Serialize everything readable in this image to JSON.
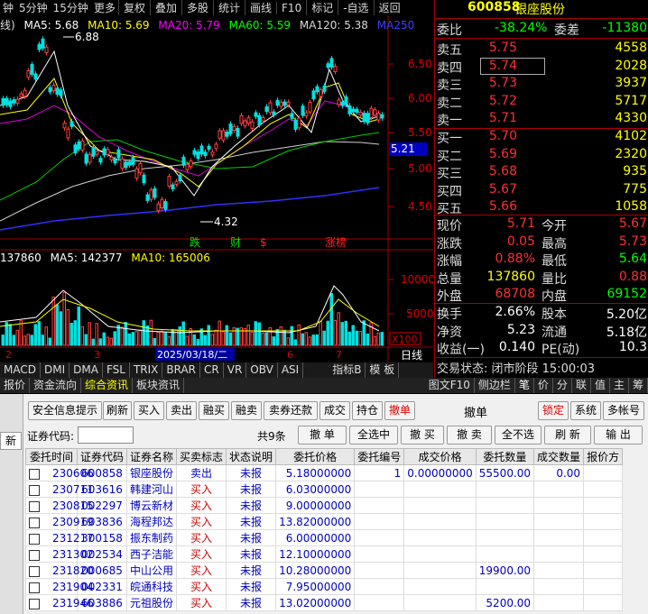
{
  "toolbar": {
    "periods": [
      "钟",
      "5分钟",
      "15分钟",
      "更多"
    ],
    "buttons": [
      "复权",
      "叠加",
      "多股",
      "统计",
      "画线",
      "F10",
      "标记",
      "-自选",
      "返回"
    ]
  },
  "chart": {
    "ma_legend": {
      "prefix": "线)",
      "ma5": "MA5: 5.68",
      "ma10": "MA10: 5.69",
      "ma20": "MA20: 5.79",
      "ma60": "MA60: 5.59",
      "ma120": "MA120: 5.38",
      "ma250": "MA250"
    },
    "price_ticks": [
      "6.50",
      "6.00",
      "5.50",
      "5.00",
      "4.50"
    ],
    "current_price_tag": "5.21",
    "high_label": "6.88",
    "low_label": "4.32",
    "event_markers": [
      "跌",
      "财",
      "$",
      "涨榜"
    ],
    "vol_legend": {
      "vol": "137860",
      "ma5": "MA5: 142377",
      "ma10": "MA10: 165006"
    },
    "vol_ticks": [
      "10000",
      "5000"
    ],
    "vol_unit": "X100",
    "month_ticks": [
      "2",
      "3",
      "6",
      "7"
    ],
    "date_label": "2025/03/18/二",
    "day_label": "日线",
    "colors": {
      "ma5": "#ffffff",
      "ma10": "#ffff00",
      "ma20": "#ff00ff",
      "ma60": "#00ff00",
      "ma120": "#d0d0d0",
      "ma250": "#4040ff"
    }
  },
  "indicator_tabs": [
    "MACD",
    "DMI",
    "DMA",
    "FSL",
    "TRIX",
    "BRAR",
    "CR",
    "VR",
    "OBV",
    "ASI",
    "指标B",
    "模 板"
  ],
  "quote": {
    "code": "600858",
    "name": "银座股份",
    "weibi_label": "委比",
    "weibi": "-38.24%",
    "weicha_label": "委差",
    "weicha": "-11380",
    "asks": [
      {
        "label": "卖五",
        "price": "5.75",
        "vol": "4558"
      },
      {
        "label": "卖四",
        "price": "5.74",
        "vol": "2028"
      },
      {
        "label": "卖三",
        "price": "5.73",
        "vol": "3937"
      },
      {
        "label": "卖二",
        "price": "5.72",
        "vol": "5717"
      },
      {
        "label": "卖一",
        "price": "5.71",
        "vol": "4330"
      }
    ],
    "bids": [
      {
        "label": "买一",
        "price": "5.70",
        "vol": "4102"
      },
      {
        "label": "买二",
        "price": "5.69",
        "vol": "2320"
      },
      {
        "label": "买三",
        "price": "5.68",
        "vol": "935"
      },
      {
        "label": "买四",
        "price": "5.67",
        "vol": "775"
      },
      {
        "label": "买五",
        "price": "5.66",
        "vol": "1058"
      }
    ],
    "stats": [
      {
        "l1": "现价",
        "v1": "5.71",
        "l2": "今开",
        "v2": "5.67"
      },
      {
        "l1": "涨跌",
        "v1": "0.05",
        "l2": "最高",
        "v2": "5.73"
      },
      {
        "l1": "涨幅",
        "v1": "0.88%",
        "l2": "最低",
        "v2": "5.64"
      },
      {
        "l1": "总量",
        "v1": "137860",
        "l2": "量比",
        "v2": "0.88"
      },
      {
        "l1": "外盘",
        "v1": "68708",
        "l2": "内盘",
        "v2": "69152"
      }
    ],
    "stats2": [
      {
        "l1": "换手",
        "v1": "2.66%",
        "l2": "股本",
        "v2": "5.20亿"
      },
      {
        "l1": "净资",
        "v1": "5.23",
        "l2": "流通",
        "v2": "5.18亿"
      },
      {
        "l1": "收益(一)",
        "v1": "0.140",
        "l2": "PE(动)",
        "v2": "10.3"
      }
    ],
    "status": "交易状态: 闭市阶段 15:00:03",
    "tabs": [
      "笔",
      "价",
      "分",
      "联",
      "值",
      "主",
      "筹"
    ]
  },
  "bottom_tabs": [
    "报价",
    "资金流向",
    "综合资讯",
    "板块资讯"
  ],
  "bottom_right": [
    "图文F10",
    "侧边栏"
  ],
  "trade": {
    "top_buttons": [
      "安全信息提示",
      "刷新",
      "买入",
      "卖出",
      "融买",
      "融卖",
      "卖券还款",
      "成交",
      "持仓",
      "撤单"
    ],
    "right_buttons": [
      "锁定",
      "系统",
      "多帐号"
    ],
    "panel_title": "撤单",
    "code_label": "证券代码:",
    "count": "共9条",
    "action_buttons": [
      "撤 单",
      "全选中",
      "撤 买",
      "撤 卖",
      "全不选",
      "刷 新",
      "输 出"
    ],
    "side_label": "新",
    "columns": [
      "委托时间",
      "证券代码",
      "证券名称",
      "买卖标志",
      "状态说明",
      "委托价格",
      "委托编号",
      "成交价格",
      "委托数量",
      "成交数量",
      "报价方"
    ],
    "rows": [
      {
        "time": "230606",
        "code": "600858",
        "name": "银座股份",
        "side": "卖出",
        "status": "未报",
        "price": "5.18000000",
        "no": "1",
        "deal_price": "0.00000000",
        "qty": "55500.00",
        "deal_qty": "0.00"
      },
      {
        "time": "230711",
        "code": "603616",
        "name": "韩建河山",
        "side": "买入",
        "status": "未报",
        "price": "6.03000000",
        "no": "",
        "deal_price": "",
        "qty": "",
        "deal_qty": ""
      },
      {
        "time": "230815",
        "code": "002297",
        "name": "博云新材",
        "side": "买入",
        "status": "未报",
        "price": "9.00000000",
        "no": "",
        "deal_price": "",
        "qty": "",
        "deal_qty": ""
      },
      {
        "time": "230919",
        "code": "603836",
        "name": "海程邦达",
        "side": "买入",
        "status": "未报",
        "price": "13.82000000",
        "no": "",
        "deal_price": "",
        "qty": "",
        "deal_qty": ""
      },
      {
        "time": "231217",
        "code": "300158",
        "name": "振东制药",
        "side": "买入",
        "status": "未报",
        "price": "6.00000000",
        "no": "",
        "deal_price": "",
        "qty": "",
        "deal_qty": ""
      },
      {
        "time": "231302",
        "code": "002534",
        "name": "西子洁能",
        "side": "买入",
        "status": "未报",
        "price": "12.10000000",
        "no": "",
        "deal_price": "",
        "qty": "",
        "deal_qty": ""
      },
      {
        "time": "231820",
        "code": "000685",
        "name": "中山公用",
        "side": "买入",
        "status": "未报",
        "price": "10.28000000",
        "no": "",
        "deal_price": "",
        "qty": "19900.00",
        "deal_qty": ""
      },
      {
        "time": "231904",
        "code": "002331",
        "name": "皖通科技",
        "side": "买入",
        "status": "未报",
        "price": "7.95000000",
        "no": "",
        "deal_price": "",
        "qty": "",
        "deal_qty": ""
      },
      {
        "time": "231946",
        "code": "603886",
        "name": "元祖股份",
        "side": "买入",
        "status": "未报",
        "price": "13.02000000",
        "no": "",
        "deal_price": "",
        "qty": "5200.00",
        "deal_qty": ""
      }
    ]
  }
}
